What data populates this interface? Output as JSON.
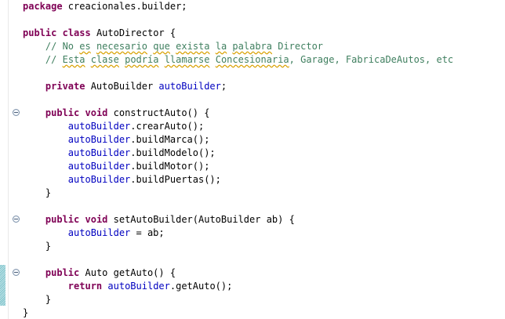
{
  "code": {
    "pkg": {
      "kw": "package",
      "rest": " creacionales.builder;"
    },
    "cls": {
      "kw1": "public",
      "kw2": "class",
      "rest": " AutoDirector {"
    },
    "c1": {
      "a": "// No ",
      "b": "es",
      "c": " ",
      "d": "necesario",
      "e": " ",
      "f": "que",
      "g": " ",
      "h": "exista",
      "i": " ",
      "j": "la",
      "k": " ",
      "l": "palabra",
      "m": " Director"
    },
    "c2": {
      "a": "// ",
      "b": "Esta",
      "c": " ",
      "d": "clase",
      "e": " ",
      "f": "podría",
      "g": " ",
      "h": "llamarse",
      "i": " ",
      "j": "Concesionaria",
      "k": ", Garage, FabricaDeAutos, etc"
    },
    "field": {
      "kw": "private",
      "type": " AutoBuilder ",
      "name": "autoBuilder",
      "end": ";"
    },
    "m1": {
      "kw1": "public",
      "kw2": "void",
      "rest": " constructAuto() {"
    },
    "s1": {
      "f": "autoBuilder",
      "rest": ".crearAuto();"
    },
    "s2": {
      "f": "autoBuilder",
      "rest": ".buildMarca();"
    },
    "s3": {
      "f": "autoBuilder",
      "rest": ".buildModelo();"
    },
    "s4": {
      "f": "autoBuilder",
      "rest": ".buildMotor();"
    },
    "s5": {
      "f": "autoBuilder",
      "rest": ".buildPuertas();"
    },
    "close1": "}",
    "m2": {
      "kw1": "public",
      "kw2": "void",
      "rest": " setAutoBuilder(AutoBuilder ab) {"
    },
    "a1": {
      "f": "autoBuilder",
      "rest": " = ab;"
    },
    "close2": "}",
    "m3": {
      "kw1": "public",
      "rest": " Auto getAuto() {"
    },
    "r1": {
      "kw": "return",
      "sp": " ",
      "f": "autoBuilder",
      "rest": ".getAuto();"
    },
    "close3": "}",
    "close4": "}"
  },
  "colors": {
    "keyword": "#7f0055",
    "comment": "#3f7f5f",
    "field": "#0000c0",
    "text": "#000000"
  },
  "icons": {
    "fold": "collapse-minus-icon",
    "change": "change-marker-icon"
  }
}
